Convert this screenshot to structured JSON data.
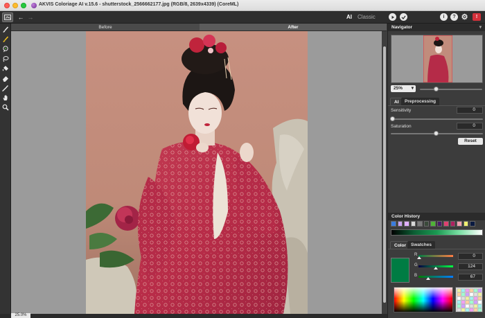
{
  "window": {
    "title": "AKVIS Coloriage AI v.15.6 - shutterstock_2566662177.jpg (RGB/8, 2639x4339) (CoreML)"
  },
  "toolbar": {
    "mode_ai": "AI",
    "mode_classic": "Classic",
    "run_icon": "play-icon",
    "apply_icon": "checkmark-icon",
    "info_label": "i",
    "help_label": "?",
    "news_label": "!"
  },
  "tools": [
    "brush-icon",
    "recoloring-brush-icon",
    "magic-fill-icon",
    "lasso-icon",
    "bucket-icon",
    "eraser-icon",
    "eyedropper-icon",
    "hand-icon",
    "zoom-icon"
  ],
  "canvas": {
    "before_tab": "Before",
    "after_tab": "After",
    "zoom_status": "25.0%"
  },
  "navigator": {
    "title": "Navigator",
    "zoom": "25%",
    "zoom_level": 0.25
  },
  "settings": {
    "tab_ai": "AI",
    "tab_preprocessing": "Preprocessing",
    "sensitivity_label": "Sensitivity",
    "sensitivity_value": "0",
    "saturation_label": "Saturation",
    "saturation_value": "0",
    "reset_label": "Reset"
  },
  "color_history": {
    "title": "Color History",
    "swatches": [
      "#3a7de0",
      "#c9a3f0",
      "#e0b0ff",
      "#d8d8d8",
      "#7a7a7a",
      "#3a4a3a",
      "#4fb336",
      "#4a1a6a",
      "#e04070",
      "#b02060",
      "#f0a0b0",
      "#f0f070",
      "#0a1a40"
    ]
  },
  "color": {
    "tab_color": "Color",
    "tab_swatches": "Swatches",
    "current_hex": "#007c43",
    "r_label": "R",
    "g_label": "G",
    "b_label": "B",
    "r": "0",
    "g": "124",
    "b": "67"
  }
}
